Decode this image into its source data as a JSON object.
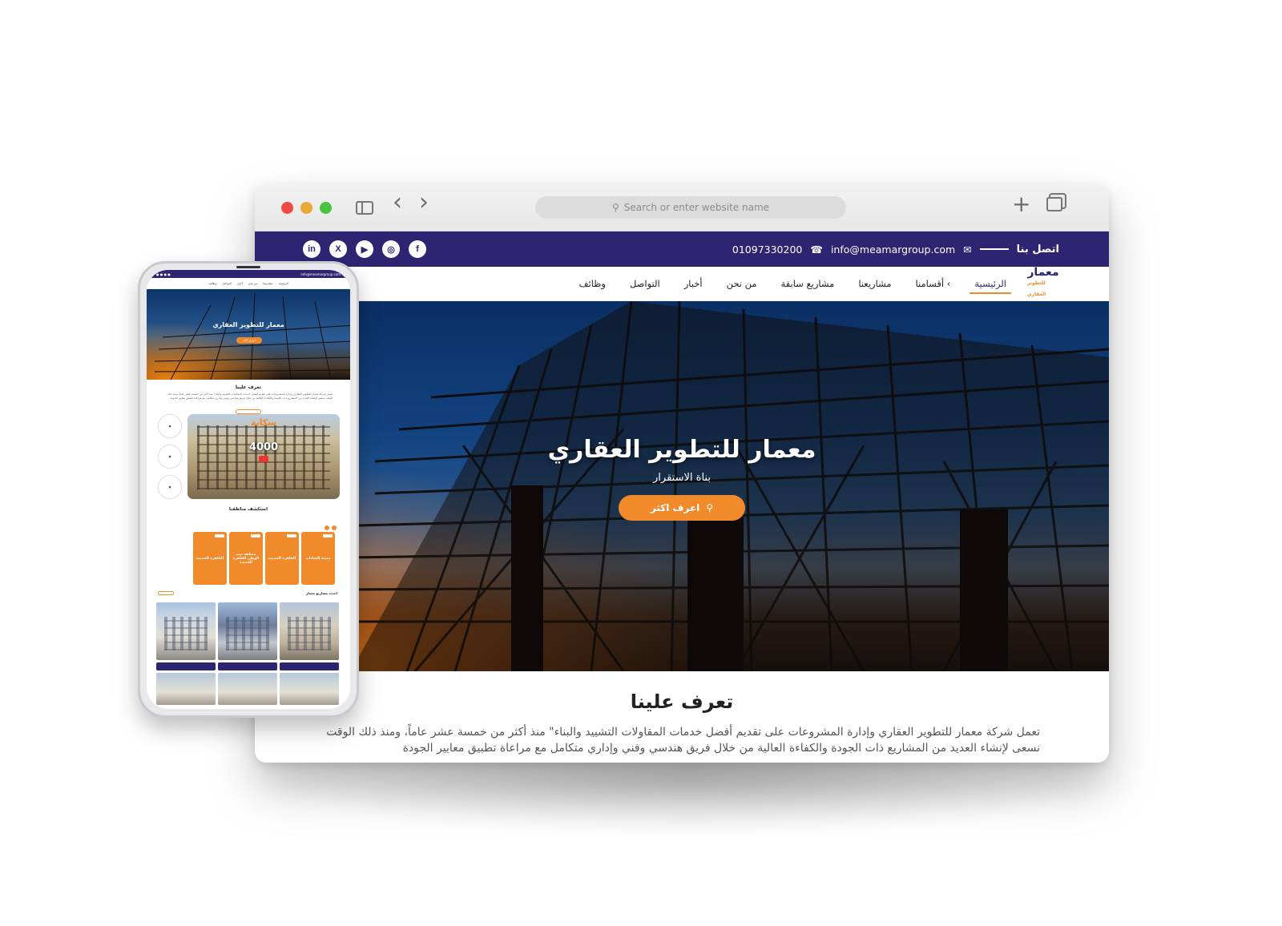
{
  "browser": {
    "address_placeholder": "Search or enter website name",
    "new_tab_glyph": "+",
    "back_glyph": "‹",
    "forward_glyph": "›"
  },
  "topbar": {
    "cta": "اتصل بنا",
    "email": "info@meamargroup.com",
    "phone": "01097330200",
    "socials": [
      "in",
      "X",
      "▶",
      "◎",
      "f"
    ]
  },
  "nav": {
    "items": [
      "الرئيسية",
      "أقسامنا ‹",
      "مشاريعنا",
      "مشاريع سابقة",
      "من نحن",
      "أخبار",
      "التواصل",
      "وظائف"
    ],
    "active_index": 0,
    "logo_text": "معمار",
    "logo_sub": "للتطوير العقاري"
  },
  "hero": {
    "title": "معمار للتطوير العقاري",
    "subtitle": "بناة الاستقرار",
    "button": "اعرف اكثر"
  },
  "about": {
    "title": "تعرف علينا",
    "paragraph": "تعمل شركة معمار للتطوير العقاري وإدارة المشروعات على تقديم أفضل خدمات المقاولات التشييد والبناء\" منذ أكثر من خمسة عشر عاماً، ومنذ ذلك الوقت نسعى لإنشاء العديد من المشاريع ذات الجودة والكفاءة العالية من خلال فريق هندسي وفني وإداري متكامل مع مراعاة تطبيق معايير الجودة"
  },
  "mobile": {
    "hero_title": "معمار للتطوير العقاري",
    "about_title": "تعرف علينا",
    "video_brand": "سكاية",
    "video_number": "4000",
    "explore_title": "استكشف مناطقنا",
    "cards": [
      "مدينة السادات",
      "القاهرة الجديدة",
      "منطقة بيت الوطن القاهرة الجديدة",
      "القاهرة الجديدة"
    ],
    "projects_title": "احدث مشاريع معمار"
  },
  "colors": {
    "brand_navy": "#2d2572",
    "accent_orange": "#f08a2a"
  }
}
